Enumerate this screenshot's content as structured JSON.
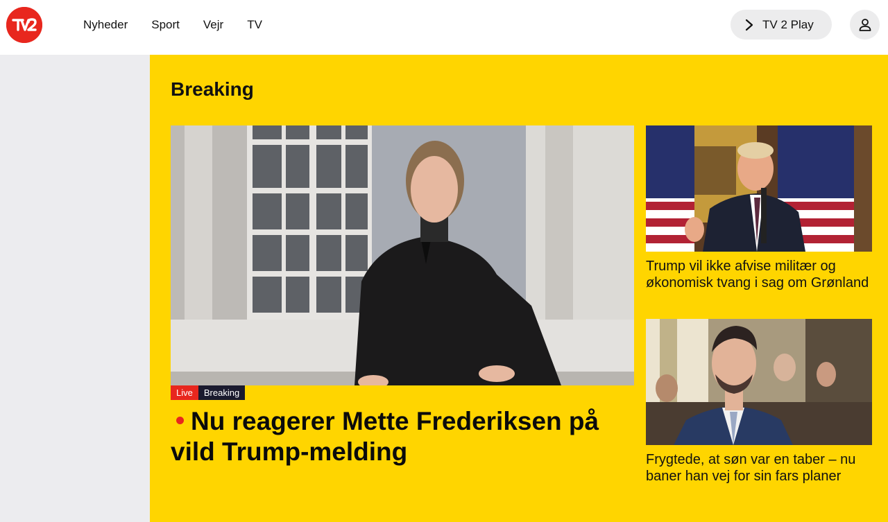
{
  "header": {
    "logo_icon": "tv2-logo",
    "nav": [
      {
        "label": "Nyheder"
      },
      {
        "label": "Sport"
      },
      {
        "label": "Vejr"
      },
      {
        "label": "TV"
      }
    ],
    "play_button": {
      "label": "TV 2 Play",
      "icon": "chevron-right-icon"
    },
    "user_icon": "user-icon"
  },
  "section": {
    "title": "Breaking"
  },
  "main_article": {
    "tags": {
      "live": "Live",
      "breaking": "Breaking"
    },
    "headline": "Nu reagerer Mette Frederiksen på vild Trump-melding"
  },
  "side_articles": [
    {
      "headline": "Trump vil ikke afvise militær og økonomisk tvang i sag om Grønland"
    },
    {
      "headline": "Frygtede, at søn var en taber – nu baner han vej for sin fars planer"
    }
  ],
  "colors": {
    "brand_red": "#e8271e",
    "breaking_yellow": "#ffd500",
    "tag_dark": "#1a1a2e"
  }
}
